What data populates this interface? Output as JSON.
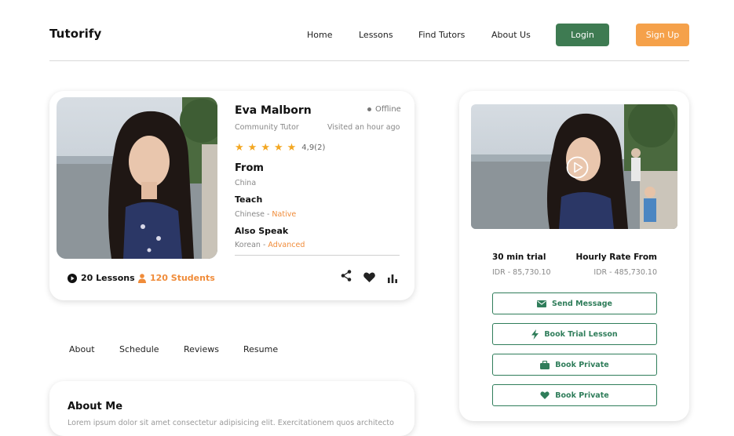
{
  "header": {
    "logo": "Tutorify",
    "nav": [
      "Home",
      "Lessons",
      "Find Tutors",
      "About Us"
    ],
    "login": "Login",
    "signup": "Sign Up"
  },
  "profile": {
    "name": "Eva Malborn",
    "status": "Offline",
    "role": "Community Tutor",
    "last_visit": "Visited an hour ago",
    "rating_text": "4,9(2)",
    "rating_stars": 5,
    "from_label": "From",
    "from_value": "China",
    "teach_label": "Teach",
    "teach_value": "Chinese - ",
    "teach_level": "Native",
    "speak_label": "Also Speak",
    "speak_value": "Korean - ",
    "speak_level": "Advanced",
    "lessons": "20 Lessons",
    "students": "120 Students",
    "icons": [
      "play-circle-icon",
      "person-icon",
      "share-icon",
      "heart-icon",
      "bar-chart-icon"
    ]
  },
  "tabs": [
    "About",
    "Schedule",
    "Reviews",
    "Resume"
  ],
  "about": {
    "title": "About Me",
    "text": "Lorem ipsum dolor sit amet consectetur adipisicing elit. Exercitationem quos architecto"
  },
  "booking": {
    "trial_label": "30 min trial",
    "trial_price": "IDR - 85,730.10",
    "rate_label": "Hourly Rate From",
    "rate_price": "IDR - 485,730.10",
    "buttons": [
      {
        "label": "Send Message",
        "icon": "mail-icon"
      },
      {
        "label": "Book Trial Lesson",
        "icon": "lightning-icon"
      },
      {
        "label": "Book Private",
        "icon": "briefcase-icon"
      },
      {
        "label": "Book Private",
        "icon": "heart-icon"
      }
    ]
  },
  "colors": {
    "green": "#3e7b52",
    "orange": "#f5a14a",
    "outline_green": "#2f7d5a",
    "star": "#f3a722"
  }
}
